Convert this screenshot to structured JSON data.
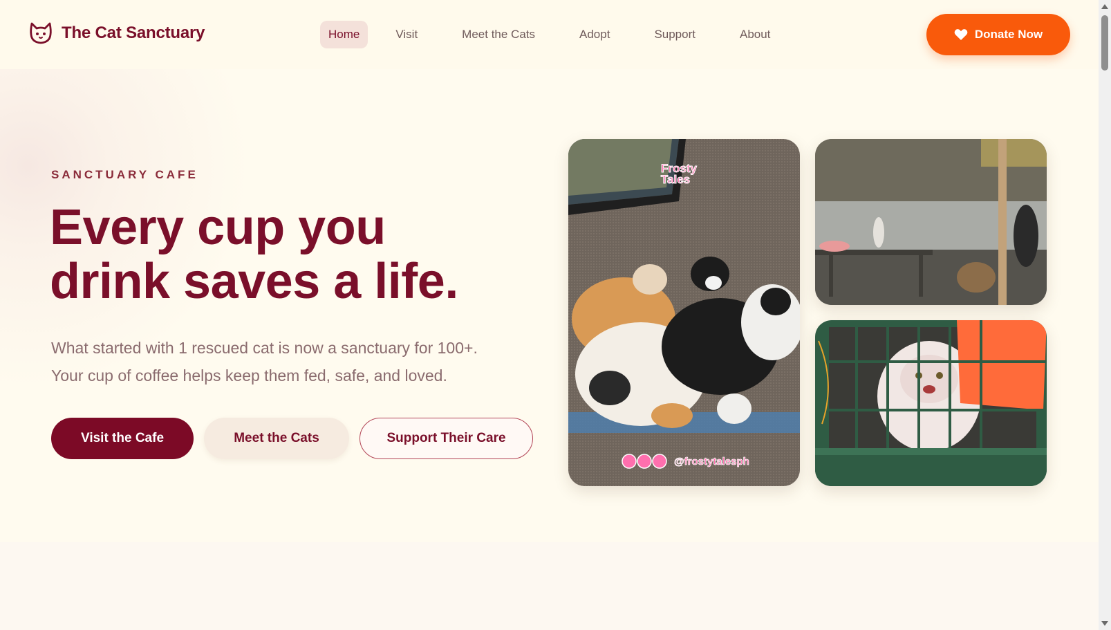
{
  "header": {
    "brand_name": "The Cat Sanctuary",
    "brand_icon": "cat-face-icon",
    "nav": [
      {
        "label": "Home",
        "active": true
      },
      {
        "label": "Visit",
        "active": false
      },
      {
        "label": "Meet the Cats",
        "active": false
      },
      {
        "label": "Adopt",
        "active": false
      },
      {
        "label": "Support",
        "active": false
      },
      {
        "label": "About",
        "active": false
      }
    ],
    "donate_label": "Donate Now",
    "donate_icon": "heart-icon"
  },
  "hero": {
    "eyebrow": "SANCTUARY CAFE",
    "headline_line1": "Every cup you",
    "headline_line2": "drink saves a life.",
    "subtext_line1": "What started with 1 rescued cat is now a sanctuary for 100+.",
    "subtext_line2": "Your cup of coffee helps keep them fed, safe, and loved.",
    "buttons": {
      "visit": "Visit the Cafe",
      "meet": "Meet the Cats",
      "support": "Support Their Care"
    },
    "photo_main": {
      "watermark_line1": "Frosty",
      "watermark_line2": "Tales",
      "handle": "@frostytalesph"
    }
  },
  "colors": {
    "brand": "#7a0f2a",
    "accent": "#f95a0b",
    "background": "#fffbef"
  }
}
